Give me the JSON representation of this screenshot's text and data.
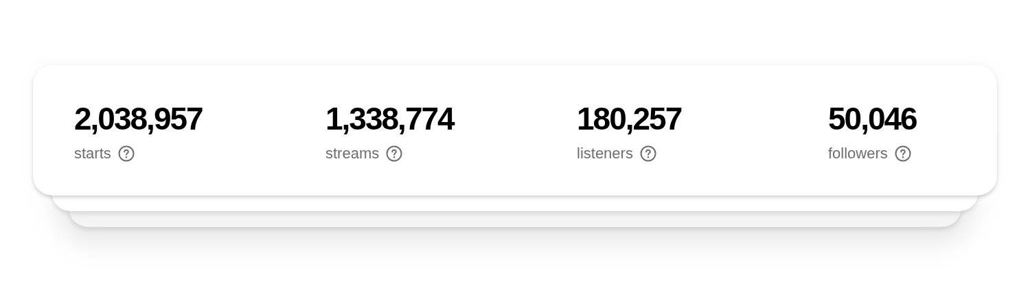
{
  "stats": [
    {
      "value": "2,038,957",
      "label": "starts"
    },
    {
      "value": "1,338,774",
      "label": "streams"
    },
    {
      "value": "180,257",
      "label": "listeners"
    },
    {
      "value": "50,046",
      "label": "followers"
    }
  ]
}
